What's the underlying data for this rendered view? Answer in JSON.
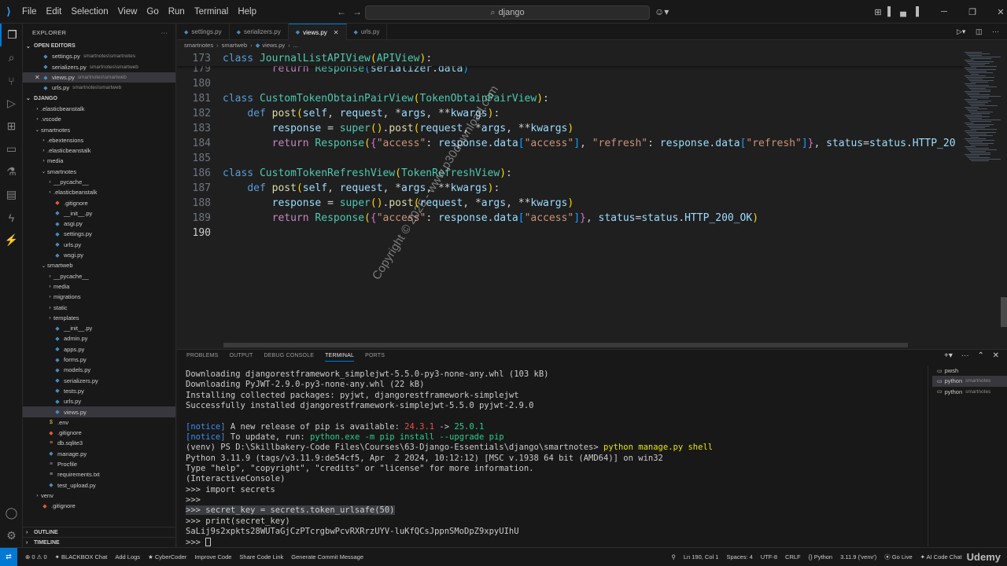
{
  "titlebar": {
    "menu": [
      "File",
      "Edit",
      "Selection",
      "View",
      "Go",
      "Run",
      "Terminal",
      "Help"
    ],
    "search": "django"
  },
  "explorer": {
    "title": "EXPLORER",
    "open_editors_title": "OPEN EDITORS",
    "open_editors": [
      {
        "name": "settings.py",
        "desc": "smartnotes\\smartnotes"
      },
      {
        "name": "serializers.py",
        "desc": "smartnotes\\smartweb"
      },
      {
        "name": "views.py",
        "desc": "smartnotes\\smartweb"
      },
      {
        "name": "urls.py",
        "desc": "smartnotes\\smartweb"
      }
    ],
    "project_title": "DJANGO",
    "tree": [
      ".elasticbeanstalk",
      ".vscode",
      "smartnotes",
      ".ebextensions",
      ".elasticbeanstalk",
      "media",
      "smartnotes",
      "__pycache__",
      ".elasticbeanstalk",
      ".gitignore",
      "__init__.py",
      "asgi.py",
      "settings.py",
      "urls.py",
      "wsgi.py",
      "smartweb",
      "__pycache__",
      "media",
      "migrations",
      "static",
      "templates",
      "__init__.py",
      "admin.py",
      "apps.py",
      "forms.py",
      "models.py",
      "serializers.py",
      "tests.py",
      "urls.py",
      "views.py",
      ".env",
      ".gitignore",
      "db.sqlite3",
      "manage.py",
      "Procfile",
      "requirements.txt",
      "test_upload.py",
      "venv",
      ".gitignore"
    ],
    "outline_title": "OUTLINE",
    "timeline_title": "TIMELINE"
  },
  "tabs": [
    "settings.py",
    "serializers.py",
    "views.py",
    "urls.py"
  ],
  "breadcrumb": [
    "smartnotes",
    "smartweb",
    "views.py",
    "..."
  ],
  "editor": {
    "line_numbers": [
      "173",
      "179",
      "180",
      "181",
      "182",
      "183",
      "184",
      "185",
      "186",
      "187",
      "188",
      "189",
      "190"
    ]
  },
  "watermark": "Copyright © 2025 - www.p30download.com",
  "panel": {
    "tabs": [
      "PROBLEMS",
      "OUTPUT",
      "DEBUG CONSOLE",
      "TERMINAL",
      "PORTS"
    ],
    "terminal_lines": [
      "Downloading djangorestframework_simplejwt-5.5.0-py3-none-any.whl (103 kB)",
      "Downloading PyJWT-2.9.0-py3-none-any.whl (22 kB)",
      "Installing collected packages: pyjwt, djangorestframework-simplejwt",
      "Successfully installed djangorestframework-simplejwt-5.5.0 pyjwt-2.9.0",
      "",
      "[notice] A new release of pip is available: 24.3.1 -> 25.0.1",
      "[notice] To update, run: python.exe -m pip install --upgrade pip",
      "(venv) PS D:\\Skillbakery-Code Files\\Courses\\63-Django-Essentials\\django\\smartnotes> python manage.py shell",
      "Python 3.11.9 (tags/v3.11.9:de54cf5, Apr  2 2024, 10:12:12) [MSC v.1938 64 bit (AMD64)] on win32",
      "Type \"help\", \"copyright\", \"credits\" or \"license\" for more information.",
      "(InteractiveConsole)",
      ">>> import secrets",
      ">>>",
      ">>> secret_key = secrets.token_urlsafe(50)",
      ">>> print(secret_key)",
      "SaLij9s2xpkts28WUTaGjCzPTcrgbwPcvRXRrzUYV-luKfQCsJppnSMoDpZ9xpyUIhU",
      ">>> "
    ],
    "notice_tag": "[notice]",
    "notice_msg1": " A new release of pip is available: ",
    "notice_old": "24.3.1",
    "notice_arrow": " -> ",
    "notice_new": "25.0.1",
    "notice_msg2": " To update, run: ",
    "notice_cmd": "python.exe -m pip install --upgrade pip",
    "ps_prefix": "(venv) PS D:\\Skillbakery-Code Files\\Courses\\63-Django-Essentials\\django\\smartnotes> ",
    "ps_cmd": "python manage.py shell",
    "terminals": [
      {
        "name": "pwsh",
        "desc": ""
      },
      {
        "name": "python",
        "desc": "smartnotes"
      },
      {
        "name": "python",
        "desc": "smartnotes"
      }
    ]
  },
  "statusbar": {
    "left": [
      "0",
      "0",
      "BLACKBOX Chat",
      "Add Logs",
      "CyberCoder",
      "Improve Code",
      "Share Code Link",
      "Generate Commit Message"
    ],
    "right": [
      "Ln 190, Col 1",
      "Spaces: 4",
      "UTF-8",
      "CRLF",
      "Python",
      "3.11.9 ('venv')",
      "Go Live",
      "AI Code Chat"
    ],
    "brand": "Udemy"
  }
}
